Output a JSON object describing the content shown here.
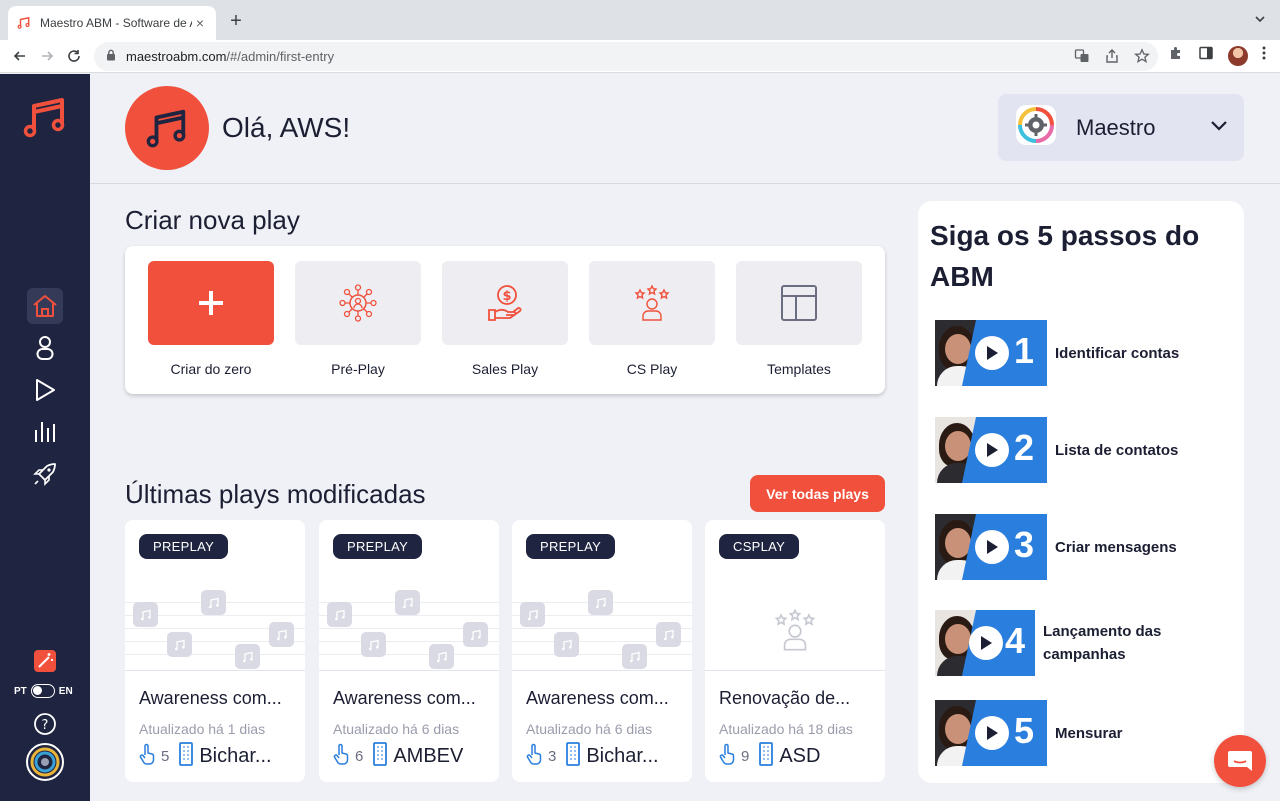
{
  "browser": {
    "tab_title": "Maestro ABM - Software de Ac",
    "tab_close": "×",
    "new_tab": "+",
    "url_host": "maestroabm.com",
    "url_path": "/#/admin/first-entry"
  },
  "header": {
    "greeting": "Olá, AWS!",
    "workspace_name": "Maestro"
  },
  "create": {
    "title": "Criar nova play",
    "options": [
      {
        "label": "Criar do zero",
        "icon": "plus-icon"
      },
      {
        "label": "Pré-Play",
        "icon": "network-icon"
      },
      {
        "label": "Sales Play",
        "icon": "money-hand-icon"
      },
      {
        "label": "CS Play",
        "icon": "stars-user-icon"
      },
      {
        "label": "Templates",
        "icon": "template-icon"
      }
    ]
  },
  "recent": {
    "title": "Últimas plays modificadas",
    "view_all": "Ver todas plays",
    "cards": [
      {
        "badge": "PREPLAY",
        "title": "Awareness com...",
        "updated": "Atualizado há 1 dias",
        "count": "5",
        "company": "Bichar..."
      },
      {
        "badge": "PREPLAY",
        "title": "Awareness com...",
        "updated": "Atualizado há 6 dias",
        "count": "6",
        "company": "AMBEV"
      },
      {
        "badge": "PREPLAY",
        "title": "Awareness com...",
        "updated": "Atualizado há 6 dias",
        "count": "3",
        "company": "Bichar..."
      },
      {
        "badge": "CSPLAY",
        "title": "Renovação de...",
        "updated": "Atualizado há 18 dias",
        "count": "9",
        "company": "ASD"
      }
    ]
  },
  "steps": {
    "title": "Siga os 5 passos do ABM",
    "items": [
      {
        "num": "1",
        "label": "Identificar contas"
      },
      {
        "num": "2",
        "label": "Lista de contatos"
      },
      {
        "num": "3",
        "label": "Criar mensagens"
      },
      {
        "num": "4",
        "label": "Lançamento das campanhas"
      },
      {
        "num": "5",
        "label": "Mensurar"
      }
    ]
  },
  "sidebar": {
    "lang_left": "PT",
    "lang_right": "EN",
    "help": "?"
  },
  "colors": {
    "brand": "#f0503c",
    "navy": "#1f2440",
    "step_blue": "#2a7fde"
  }
}
